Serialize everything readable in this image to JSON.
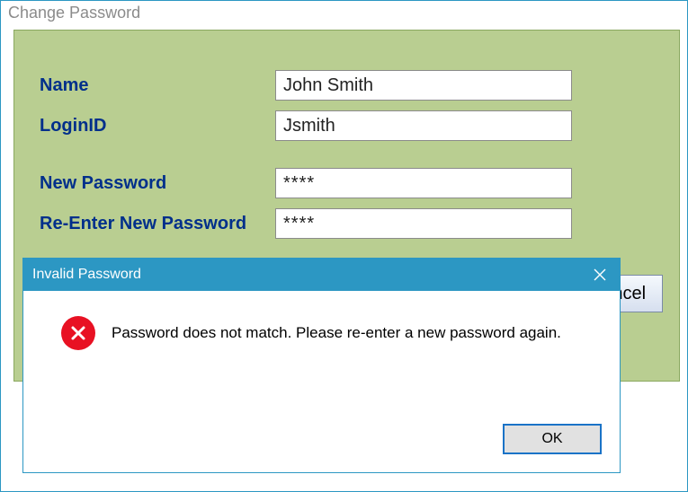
{
  "window": {
    "title": "Change Password"
  },
  "form": {
    "name": {
      "label": "Name",
      "value": "John Smith"
    },
    "loginId": {
      "label": "LoginID",
      "value": "Jsmith"
    },
    "newPassword": {
      "label": "New Password",
      "value": "****"
    },
    "reenter": {
      "label": "Re-Enter New Password",
      "value": "****"
    }
  },
  "buttons": {
    "ok": "OK",
    "cancel": "Cancel"
  },
  "dialog": {
    "title": "Invalid Password",
    "message": "Password does not match. Please re-enter a new password again.",
    "ok": "OK"
  }
}
